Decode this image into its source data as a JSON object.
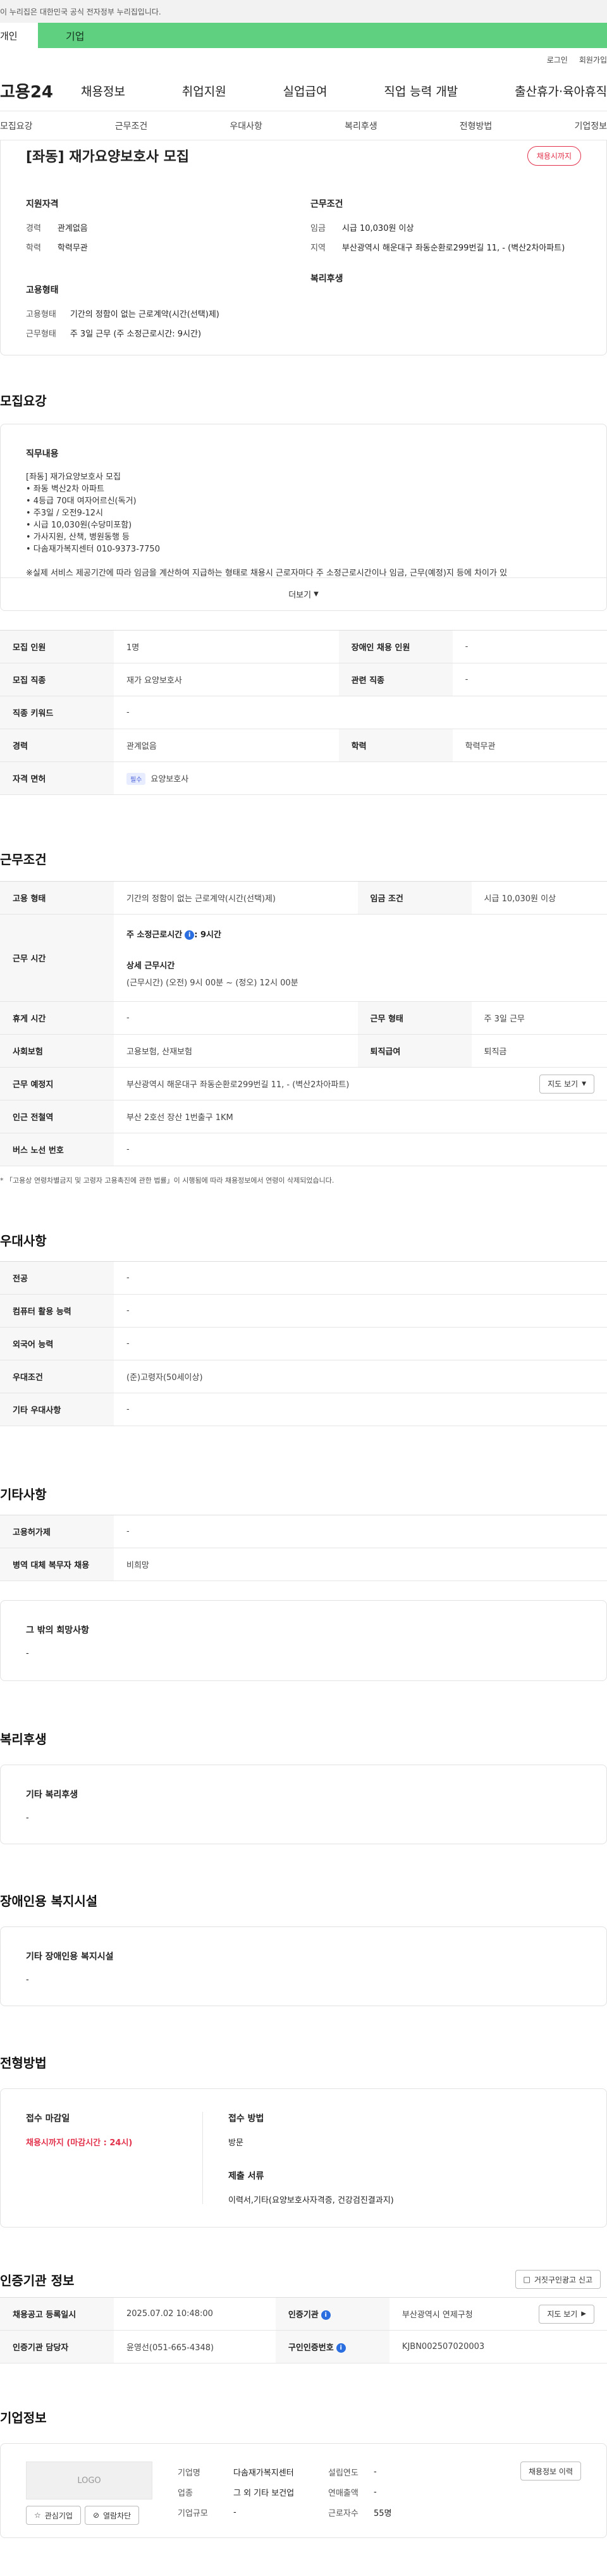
{
  "gov_banner": "이 누리집은 대한민국 공식 전자정부 누리집입니다.",
  "top_tabs": {
    "personal": "개인",
    "company": "기업"
  },
  "util": {
    "login": "로그인",
    "join": "회원가입"
  },
  "gnb": {
    "logo": "고용24",
    "menu": [
      "채용정보",
      "취업지원",
      "실업급여",
      "직업 능력 개발",
      "출산휴가·육아휴직"
    ]
  },
  "anchor_nav": [
    "모집요강",
    "근무조건",
    "우대사항",
    "복리후생",
    "전형방법",
    "기업정보"
  ],
  "job": {
    "title": "[좌동] 재가요양보호사 모집",
    "status_badge": "채용시까지",
    "qual_title": "지원자격",
    "qual": [
      {
        "k": "경력",
        "v": "관계없음"
      },
      {
        "k": "학력",
        "v": "학력무관"
      }
    ],
    "cond_title": "근무조건",
    "cond": [
      {
        "k": "임금",
        "v": "시급 10,030원 이상"
      },
      {
        "k": "지역",
        "v": "부산광역시 해운대구 좌동순환로299번길 11, - (벽산2차아파트)"
      }
    ],
    "emp_title": "고용형태",
    "emp": [
      {
        "k": "고용형태",
        "v": "기간의 정함이 없는 근로계약(시간(선택)제)"
      },
      {
        "k": "근무형태",
        "v": "주 3일 근무 (주 소정근로시간: 9시간)"
      }
    ],
    "welfare_title": "복리후생"
  },
  "recruit": {
    "title": "모집요강",
    "duty_title": "직무내용",
    "duty_lines": [
      "[좌동] 재가요양보호사 모집",
      "• 좌동 벽산2차 아파트",
      "• 4등급 70대 여자어르신(독거)",
      "• 주3일 / 오전9-12시",
      "• 시급 10,030원(수당미포함)",
      "• 가사지원, 산책, 병원동행 등",
      "• 다솜재가복지센터 010-9373-7750",
      "",
      "※실제 서비스 제공기간에 따라 임금을 계산하여 지급하는 형태로 채용시 근로자마다 주 소정근로시간이나 임금, 근무(예정)지 등에 차이가 있"
    ],
    "more": "더보기",
    "rows": [
      {
        "h1": "모집 인원",
        "v1": "1명",
        "h2": "장애인 채용 인원",
        "v2": "-"
      },
      {
        "h1": "모집 직종",
        "v1": "재가 요양보호사",
        "h2": "관련 직종",
        "v2": "-"
      },
      {
        "h1": "직종 키워드",
        "v1": "-"
      },
      {
        "h1": "경력",
        "v1": "관계없음",
        "h2": "학력",
        "v2": "학력무관"
      },
      {
        "h1": "자격 면허",
        "chip": "필수",
        "v1": "요양보호사"
      }
    ]
  },
  "work": {
    "title": "근무조건",
    "emp_h": "고용 형태",
    "emp_v": "기간의 정함이 없는 근로계약(시간(선택)제)",
    "wage_h": "임금 조건",
    "wage_v": "시급 10,030원 이상",
    "time_h": "근무 시간",
    "time_label": "주 소정근로시간",
    "time_val": ": 9시간",
    "detail_label": "상세 근무시간",
    "detail_val": "(근무시간) (오전) 9시 00분 ~ (정오) 12시 00분",
    "rest_h": "휴게 시간",
    "rest_v": "-",
    "form_h": "근무 형태",
    "form_v": "주 3일 근무",
    "ins_h": "사회보험",
    "ins_v": "고용보험, 산재보험",
    "sev_h": "퇴직급여",
    "sev_v": "퇴직금",
    "place_h": "근무 예정지",
    "place_v": "부산광역시 해운대구 좌동순환로299번길 11, - (벽산2차아파트)",
    "map_btn": "지도 보기",
    "sub_h": "인근 전철역",
    "sub_v": "부산 2호선 장산 1번출구 1KM",
    "bus_h": "버스 노선 번호",
    "bus_v": "-",
    "note": "* 「고용상 연령차별금지 및 고령자 고용촉진에 관한 법률」이 시행됨에 따라 채용정보에서 연령이 삭제되었습니다."
  },
  "pref": {
    "title": "우대사항",
    "rows": [
      {
        "h": "전공",
        "v": "-"
      },
      {
        "h": "컴퓨터 활용 능력",
        "v": "-"
      },
      {
        "h": "외국어 능력",
        "v": "-"
      },
      {
        "h": "우대조건",
        "v": "(준)고령자(50세이상)"
      },
      {
        "h": "기타 우대사항",
        "v": "-"
      }
    ]
  },
  "etc": {
    "title": "기타사항",
    "rows": [
      {
        "h": "고용허가제",
        "v": "-"
      },
      {
        "h": "병역 대체 복무자 채용",
        "v": "비희망"
      }
    ],
    "wish_title": "그 밖의 희망사항",
    "wish_v": "-"
  },
  "welfare": {
    "title": "복리후생",
    "box_title": "기타 복리후생",
    "box_v": "-"
  },
  "disabled": {
    "title": "장애인용 복지시설",
    "box_title": "기타 장애인용 복지시설",
    "box_v": "-"
  },
  "process": {
    "title": "전형방법",
    "deadline_title": "접수 마감일",
    "deadline_v": "채용시까지 (마감시간 : 24시)",
    "method_title": "접수 방법",
    "method_v": "방문",
    "docs_title": "제출 서류",
    "docs_v": "이력서,기타(요양보호사자격증, 건강검진결과지)"
  },
  "cert": {
    "title": "인증기관 정보",
    "report_btn": "거짓구인광고 신고",
    "reg_h": "채용공고 등록일시",
    "reg_v": "2025.07.02 10:48:00",
    "org_h": "인증기관",
    "org_v": "부산광역시 연제구청",
    "map_btn": "지도 보기",
    "mgr_h": "인증기관 담당자",
    "mgr_v": "윤영선(051-665-4348)",
    "no_h": "구인인증번호",
    "no_v": "KJBN002507020003"
  },
  "company": {
    "title": "기업정보",
    "logo": "LOGO",
    "fav_btn": "관심기업",
    "block_btn": "열람차단",
    "history_btn": "채용정보 이력",
    "rows": [
      {
        "k1": "기업명",
        "v1": "다솜재가복지센터",
        "k2": "설립연도",
        "v2": "-"
      },
      {
        "k1": "업종",
        "v1": "그 외 기타 보건업",
        "k2": "연매출액",
        "v2": "-"
      },
      {
        "k1": "기업규모",
        "v1": "-",
        "k2": "근로자수",
        "v2": "55명"
      }
    ]
  },
  "colors": {
    "green": "#5fcf80",
    "red": "#e3324c",
    "blue": "#2a6ee0"
  }
}
